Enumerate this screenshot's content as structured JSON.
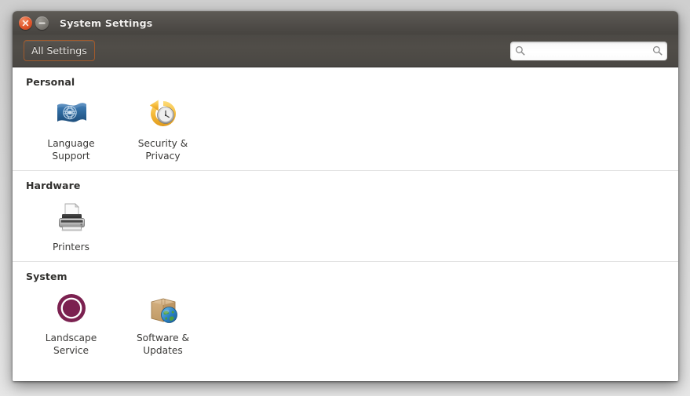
{
  "window": {
    "title": "System Settings",
    "controls": [
      {
        "name": "close-button",
        "icon": "close-icon",
        "color": "#e2562b"
      },
      {
        "name": "minimize-button",
        "icon": "minimize-icon",
        "color": "#7d7a74"
      }
    ]
  },
  "toolbar": {
    "all_settings_label": "All Settings",
    "search": {
      "value": "",
      "placeholder": "",
      "left_icon": "search-icon",
      "right_icon": "search-icon"
    }
  },
  "sections": [
    {
      "title": "Personal",
      "items": [
        {
          "label": "Language\nSupport",
          "icon": "language-support-icon"
        },
        {
          "label": "Security &\nPrivacy",
          "icon": "security-privacy-icon"
        }
      ]
    },
    {
      "title": "Hardware",
      "items": [
        {
          "label": "Printers",
          "icon": "printer-icon"
        }
      ]
    },
    {
      "title": "System",
      "items": [
        {
          "label": "Landscape\nService",
          "icon": "landscape-service-icon"
        },
        {
          "label": "Software &\nUpdates",
          "icon": "software-updates-icon"
        }
      ]
    }
  ],
  "colors": {
    "titlebar": "#504d49",
    "toolbar": "#4c4945",
    "accent_border": "#a05a2c",
    "content_bg": "#ffffff",
    "separator": "#e2e2e2",
    "text_light": "#f2f0ee",
    "text_dark": "#3b3a38"
  }
}
